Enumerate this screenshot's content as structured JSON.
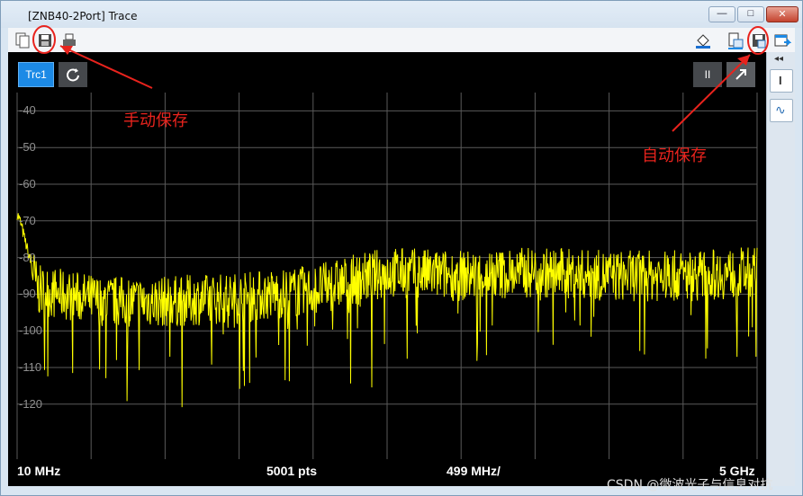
{
  "window": {
    "title": "[ZNB40-2Port] Trace",
    "min_glyph": "—",
    "max_glyph": "□",
    "close_glyph": "✕"
  },
  "toolbar": {
    "left_icons": [
      "copy-icon",
      "save-icon",
      "print-icon"
    ],
    "right_icons": [
      "fill-color-icon",
      "export-settings-icon",
      "autosave-icon",
      "window-export-icon"
    ]
  },
  "trace": {
    "tab_label": "Trc1",
    "refresh_icon": "refresh-icon",
    "pause_label": "II"
  },
  "side_panel": {
    "collapse_glyph": "◂◂",
    "marker_glyph": "I",
    "trace_glyph": "∿"
  },
  "annotations": {
    "manual_save": "手动保存",
    "auto_save": "自动保存"
  },
  "footer": {
    "start": "10 MHz",
    "points": "5001 pts",
    "per_div": "499 MHz/",
    "stop": "5 GHz"
  },
  "watermark": "CSDN @微波光子与信息对抗",
  "colors": {
    "trace": "#ffff00",
    "grid": "#5a5a5a",
    "highlight": "#e8231d",
    "active_tab": "#1c8ae6"
  },
  "chart_data": {
    "type": "line",
    "xlim": [
      0.01,
      5.0
    ],
    "ylim": [
      -130,
      -30
    ],
    "yticks": [
      -40,
      -50,
      -60,
      -70,
      -80,
      -90,
      -100,
      -110,
      -120
    ],
    "grid": true,
    "series": [
      {
        "x": [
          0.01,
          0.03,
          0.08,
          0.15,
          0.3,
          0.6,
          1.0,
          1.5,
          2.0,
          2.5,
          3.0,
          3.5,
          4.0,
          4.5,
          5.0
        ],
        "y": [
          -68,
          -70,
          -78,
          -89,
          -90,
          -92,
          -92,
          -91,
          -89,
          -84,
          -85,
          -84,
          -85,
          -85,
          -84
        ]
      }
    ]
  }
}
